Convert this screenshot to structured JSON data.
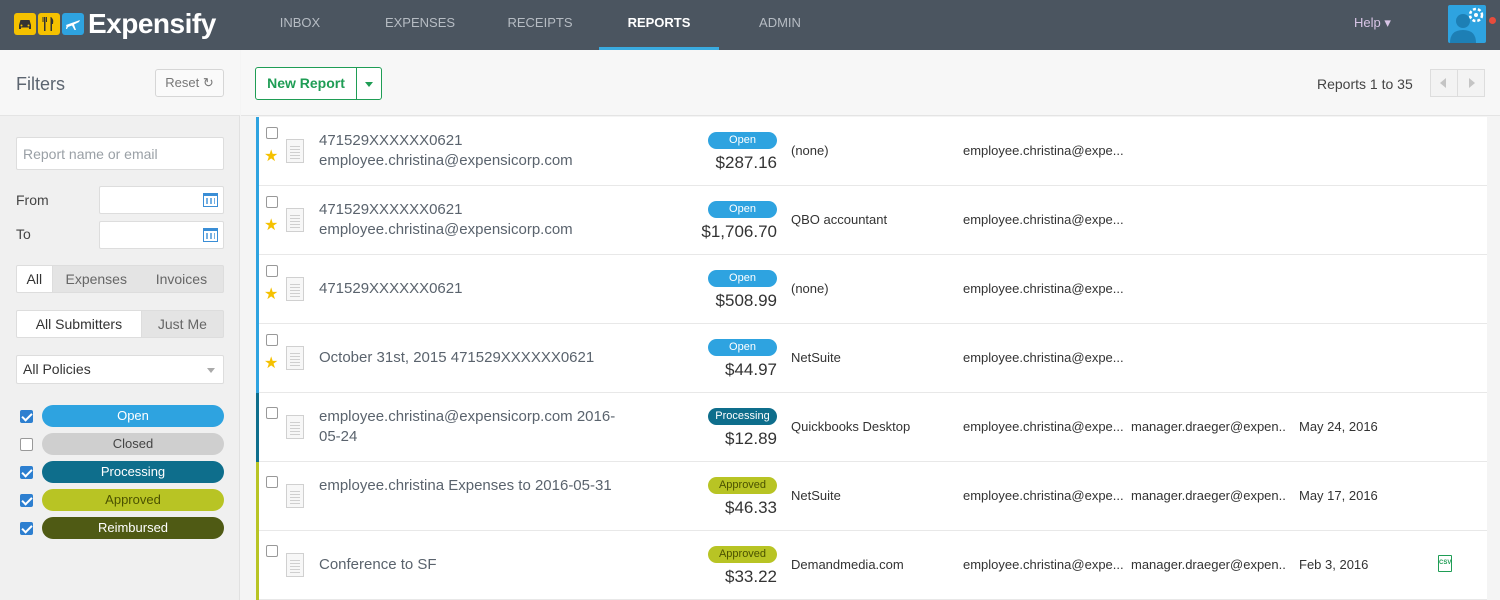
{
  "nav": {
    "app_name": "Expensify",
    "tabs": [
      {
        "label": "INBOX"
      },
      {
        "label": "EXPENSES"
      },
      {
        "label": "RECEIPTS"
      },
      {
        "label": "REPORTS",
        "active": true
      },
      {
        "label": "ADMIN"
      }
    ],
    "help_label": "Help ▾",
    "logo_icons": [
      "car-icon",
      "fork-knife-icon",
      "airplane-icon"
    ],
    "colors": {
      "bar": "#4b5560",
      "active_underline": "#3aabe0"
    }
  },
  "sidebar": {
    "title": "Filters",
    "reset_label": "Reset ↻",
    "search_placeholder": "Report name or email",
    "from_label": "From",
    "to_label": "To",
    "type_tabs": [
      "All",
      "Expenses",
      "Invoices"
    ],
    "type_active": "All",
    "submitter_tabs": [
      "All Submitters",
      "Just Me"
    ],
    "submitter_active": "All Submitters",
    "policy_select": "All Policies",
    "statuses": [
      {
        "label": "Open",
        "checked": true,
        "color": "#2ea3e0",
        "text_color": "#ffffff"
      },
      {
        "label": "Closed",
        "checked": false,
        "color": "#cfcfcf",
        "text_color": "#444444"
      },
      {
        "label": "Processing",
        "checked": true,
        "color": "#0e6e8c",
        "text_color": "#ffffff"
      },
      {
        "label": "Approved",
        "checked": true,
        "color": "#b8c424",
        "text_color": "#4b5200"
      },
      {
        "label": "Reimbursed",
        "checked": true,
        "color": "#4f5a14",
        "text_color": "#ffffff"
      }
    ]
  },
  "toolbar": {
    "new_report_label": "New Report",
    "pager_text": "Reports 1 to 35"
  },
  "reports": [
    {
      "title": "471529XXXXXX0621 employee.christina@expensicorp.com",
      "starred": true,
      "status": "Open",
      "amount": "$287.16",
      "policy": "(none)",
      "submitter": "employee.christina@expe...",
      "approver": "",
      "date": "",
      "csv": false
    },
    {
      "title": "471529XXXXXX0621 employee.christina@expensicorp.com",
      "starred": true,
      "status": "Open",
      "amount": "$1,706.70",
      "policy": "QBO accountant",
      "submitter": "employee.christina@expe...",
      "approver": "",
      "date": "",
      "csv": false
    },
    {
      "title": "471529XXXXXX0621",
      "starred": true,
      "status": "Open",
      "amount": "$508.99",
      "policy": "(none)",
      "submitter": "employee.christina@expe...",
      "approver": "",
      "date": "",
      "csv": false
    },
    {
      "title": "October 31st, 2015 471529XXXXXX0621",
      "starred": true,
      "status": "Open",
      "amount": "$44.97",
      "policy": "NetSuite",
      "submitter": "employee.christina@expe...",
      "approver": "",
      "date": "",
      "csv": false
    },
    {
      "title": "employee.christina@expensicorp.com 2016-05-24",
      "starred": false,
      "status": "Processing",
      "amount": "$12.89",
      "policy": "Quickbooks Desktop",
      "submitter": "employee.christina@expe...",
      "approver": "manager.draeger@expen...",
      "date": "May 24, 2016",
      "csv": false
    },
    {
      "title": "employee.christina Expenses to 2016-05-31",
      "starred": false,
      "status": "Approved",
      "amount": "$46.33",
      "policy": "NetSuite",
      "submitter": "employee.christina@expe...",
      "approver": "manager.draeger@expen...",
      "date": "May 17, 2016",
      "csv": false
    },
    {
      "title": "Conference to SF",
      "starred": false,
      "status": "Approved",
      "amount": "$33.22",
      "policy": "Demandmedia.com",
      "submitter": "employee.christina@expe...",
      "approver": "manager.draeger@expen...",
      "date": "Feb 3, 2016",
      "csv": true
    }
  ],
  "status_styles": {
    "Open": {
      "bg": "#2ea3e0",
      "fg": "#ffffff",
      "accent": "#2ea3e0"
    },
    "Processing": {
      "bg": "#0e6e8c",
      "fg": "#ffffff",
      "accent": "#0e6e8c"
    },
    "Approved": {
      "bg": "#b8c424",
      "fg": "#4b5200",
      "accent": "#b8c424"
    }
  },
  "csv_label": "CSV"
}
